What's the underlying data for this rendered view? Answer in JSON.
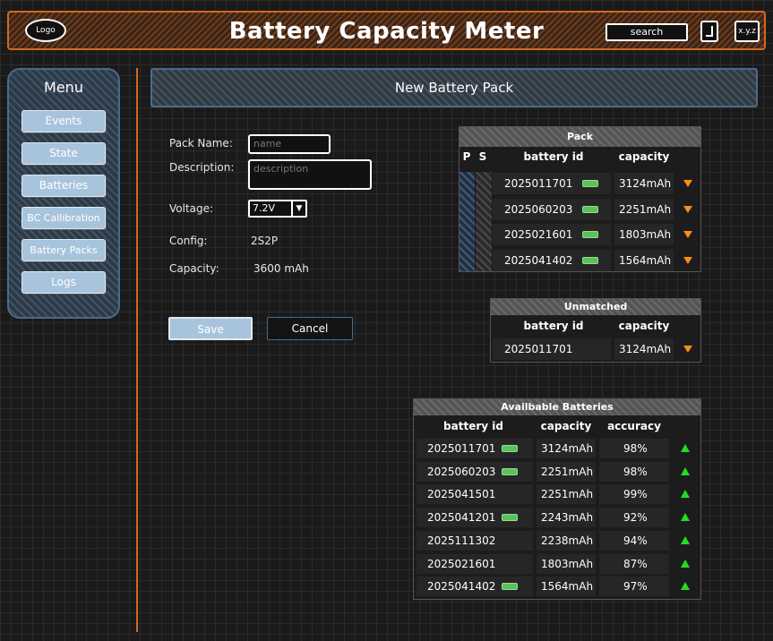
{
  "header": {
    "logo": "Logo",
    "title": "Battery Capacity Meter",
    "search": "search",
    "version": "x.y.z"
  },
  "menu": {
    "title": "Menu",
    "items": [
      "Events",
      "State",
      "Batteries",
      "BC Callibration",
      "Battery Packs",
      "Logs"
    ]
  },
  "banner": "New Battery Pack",
  "form": {
    "pack_name_label": "Pack Name:",
    "pack_name_placeholder": "name",
    "description_label": "Description:",
    "description_placeholder": "description",
    "voltage_label": "Voltage:",
    "voltage_value": "7.2V",
    "config_label": "Config:",
    "config_value": "2S2P",
    "capacity_label": "Capacity:",
    "capacity_value": "3600 mAh",
    "save": "Save",
    "cancel": "Cancel"
  },
  "pack_table": {
    "title": "Pack",
    "headers": [
      "P",
      "S",
      "battery id",
      "capacity"
    ],
    "rows": [
      {
        "id": "2025011701",
        "capacity": "3124mAh"
      },
      {
        "id": "2025060203",
        "capacity": "2251mAh"
      },
      {
        "id": "2025021601",
        "capacity": "1803mAh"
      },
      {
        "id": "2025041402",
        "capacity": "1564mAh"
      }
    ]
  },
  "unmatched_table": {
    "title": "Unmatched",
    "headers": [
      "battery id",
      "capacity"
    ],
    "rows": [
      {
        "id": "2025011701",
        "capacity": "3124mAh"
      }
    ]
  },
  "available_table": {
    "title": "Availbable Batteries",
    "headers": [
      "battery id",
      "capacity",
      "accuracy"
    ],
    "rows": [
      {
        "id": "2025011701",
        "capacity": "3124mAh",
        "accuracy": "98%",
        "icon": true
      },
      {
        "id": "2025060203",
        "capacity": "2251mAh",
        "accuracy": "98%",
        "icon": true
      },
      {
        "id": "2025041501",
        "capacity": "2251mAh",
        "accuracy": "99%",
        "icon": false
      },
      {
        "id": "2025041201",
        "capacity": "2243mAh",
        "accuracy": "92%",
        "icon": true
      },
      {
        "id": "2025111302",
        "capacity": "2238mAh",
        "accuracy": "94%",
        "icon": false
      },
      {
        "id": "2025021601",
        "capacity": "1803mAh",
        "accuracy": "87%",
        "icon": false
      },
      {
        "id": "2025041402",
        "capacity": "1564mAh",
        "accuracy": "97%",
        "icon": true
      }
    ]
  },
  "colors": {
    "accent": "#d2691e",
    "menu_button": "#a8c4dc",
    "arrow_orange": "#ff8c1a",
    "arrow_green": "#22dd22",
    "battery_green": "#5cc05c"
  },
  "icons": {
    "row_action_pack": "triangle-down-orange",
    "row_action_available": "triangle-up-green",
    "battery": "battery-icon"
  }
}
